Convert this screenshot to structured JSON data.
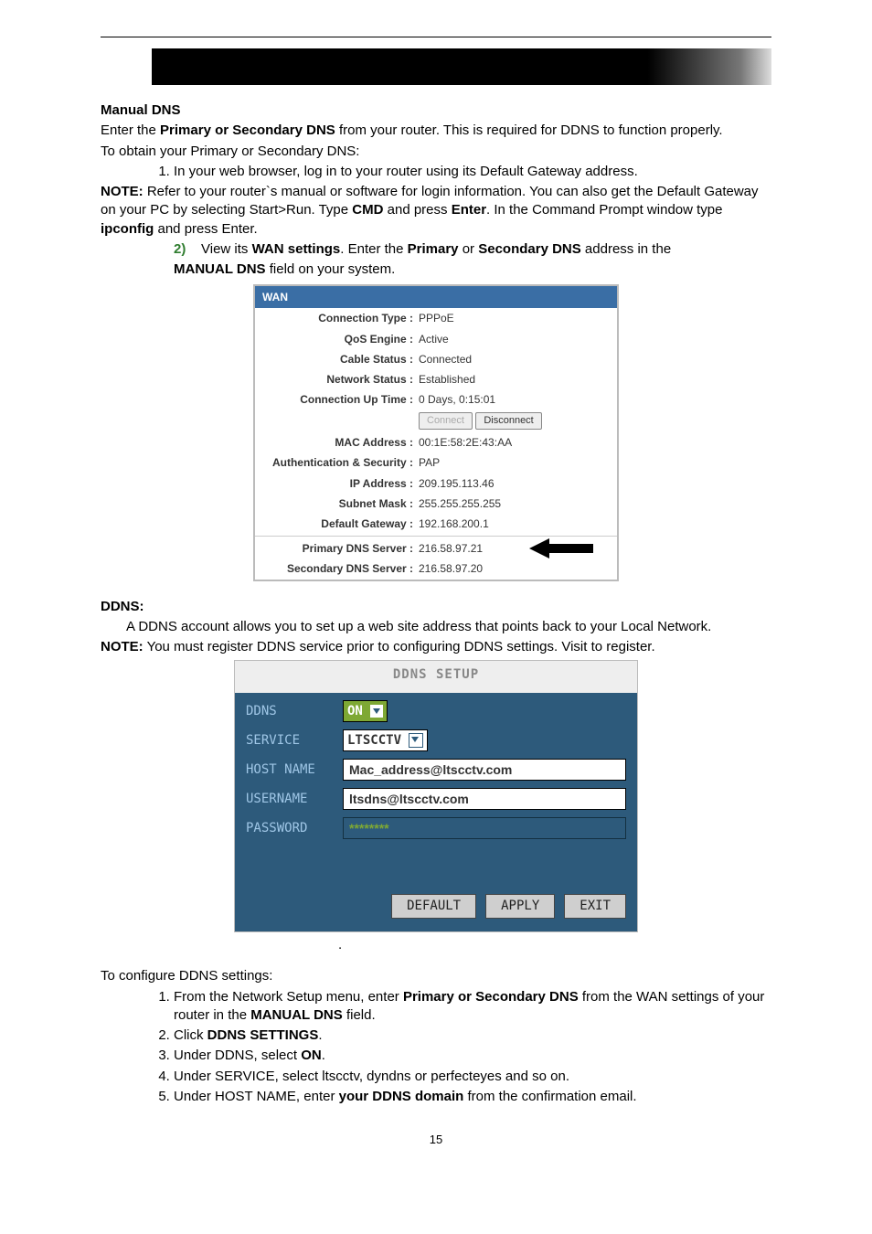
{
  "heading_manual": "Manual DNS",
  "manual_intro_1a": "Enter the ",
  "manual_intro_1b": "Primary or Secondary DNS",
  "manual_intro_1c": " from your router. This is required for DDNS to function properly.",
  "manual_intro_2": "To obtain your Primary or Secondary DNS:",
  "manual_step1": "In your web browser, log in to your router using its Default Gateway address.",
  "note_prefix": "NOTE:",
  "manual_note_a": " Refer to your router`s manual or software for login information. You can also get the Default Gateway on your PC by selecting Start>Run. Type ",
  "manual_note_b": "CMD",
  "manual_note_c": " and press ",
  "manual_note_d": "Enter",
  "manual_note_e": ". In the Command Prompt window type ",
  "manual_note_f": "ipconfig",
  "manual_note_g": " and press Enter.",
  "manual_step2_num": "2)",
  "manual_step2_a": "View its ",
  "manual_step2_b": "WAN settings",
  "manual_step2_c": ". Enter the ",
  "manual_step2_d": "Primary",
  "manual_step2_e": " or ",
  "manual_step2_f": "Secondary DNS",
  "manual_step2_g": " address in the ",
  "manual_step2_h": "MANUAL DNS",
  "manual_step2_i": " field on your system.",
  "wan": {
    "title": "WAN",
    "conn_type_l": "Connection Type :",
    "conn_type_v": "PPPoE",
    "qos_l": "QoS Engine :",
    "qos_v": "Active",
    "cable_l": "Cable Status :",
    "cable_v": "Connected",
    "net_l": "Network Status :",
    "net_v": "Established",
    "uptime_l": "Connection Up Time :",
    "uptime_v": "0 Days, 0:15:01",
    "btn_connect": "Connect",
    "btn_disconnect": "Disconnect",
    "mac_l": "MAC Address :",
    "mac_v": "00:1E:58:2E:43:AA",
    "auth_l": "Authentication & Security :",
    "auth_v": "PAP",
    "ip_l": "IP Address :",
    "ip_v": "209.195.113.46",
    "subnet_l": "Subnet Mask :",
    "subnet_v": "255.255.255.255",
    "gw_l": "Default Gateway :",
    "gw_v": "192.168.200.1",
    "pdns_l": "Primary DNS Server :",
    "pdns_v": "216.58.97.21",
    "sdns_l": "Secondary DNS Server :",
    "sdns_v": "216.58.97.20"
  },
  "ddns_heading": "DDNS:",
  "ddns_intro": "A DDNS account allows you to set up a web site address that points back to your Local Network.",
  "ddns_note": " You must register DDNS service prior to configuring DDNS settings. Visit ",
  "ddns_link": "",
  "ddns_register": " to register.",
  "ddns_panel": {
    "title": "DDNS SETUP",
    "lbl_ddns": "DDNS",
    "val_ddns": "ON",
    "lbl_service": "SERVICE",
    "val_service": "LTSCCTV",
    "lbl_host": "HOST NAME",
    "val_host": "Mac_address@ltscctv.com",
    "lbl_user": "USERNAME",
    "val_user": "ltsdns@ltscctv.com",
    "lbl_pass": "PASSWORD",
    "val_pass": "********",
    "btn_default": "DEFAULT",
    "btn_apply": "APPLY",
    "btn_exit": "EXIT"
  },
  "configure_heading": "To configure DDNS settings:",
  "cfg1_a": "From the Network Setup menu, enter ",
  "cfg1_b": "Primary or Secondary DNS",
  "cfg1_c": " from the WAN settings of your router in the ",
  "cfg1_d": "MANUAL DNS",
  "cfg1_e": " field.",
  "cfg2_a": "Click ",
  "cfg2_b": "DDNS SETTINGS",
  "cfg2_c": ".",
  "cfg3_a": "Under DDNS, select ",
  "cfg3_b": "ON",
  "cfg3_c": ".",
  "cfg4": "Under SERVICE, select ltscctv, dyndns or perfecteyes and so on.",
  "cfg5_a": "Under HOST NAME, enter ",
  "cfg5_b": "your DDNS domain",
  "cfg5_c": " from the confirmation email.",
  "page_number": "15"
}
